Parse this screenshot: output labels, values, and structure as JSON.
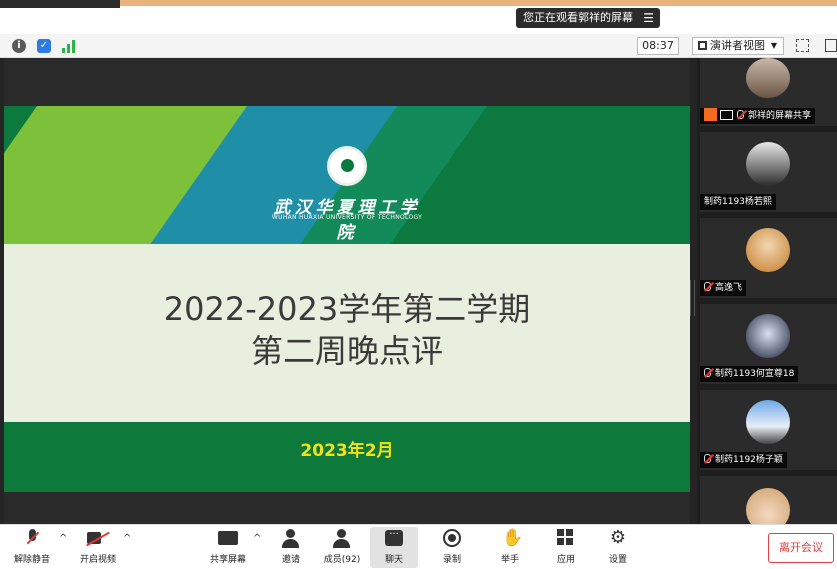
{
  "banner": {
    "viewing_text": "您正在观看郭祥的屏幕",
    "menu_icon": "menu-icon"
  },
  "toolbar": {
    "timer": "08:37",
    "view_label": "演讲者视图",
    "icons": [
      "info-icon",
      "shield-icon",
      "signal-icon",
      "fullscreen-icon",
      "window-icon"
    ]
  },
  "slide": {
    "school_name": "武汉华夏理工学院",
    "school_name_en": "WUHAN HUAXIA UNIVERSITY OF TECHNOLOGY",
    "title_line1": "2022-2023学年第二学期",
    "title_line2": "第二周晚点评",
    "date": "2023年2月",
    "colors": {
      "green": "#0c7a3e",
      "light": "#e9efdf",
      "date_yellow": "#f2e21c"
    }
  },
  "participants": [
    {
      "name": "郭祥的屏幕共享",
      "sharing": true
    },
    {
      "name": "制药1193杨若熙",
      "muted": false
    },
    {
      "name": "高逸飞",
      "muted": true
    },
    {
      "name": "制药1193何宣尊18",
      "muted": true
    },
    {
      "name": "制药1192杨子颖",
      "muted": true
    },
    {
      "name": "",
      "muted": false
    }
  ],
  "controls": {
    "unmute": "解除静音",
    "start_video": "开启视频",
    "share_screen": "共享屏幕",
    "invite": "邀请",
    "members": "成员(92)",
    "chat": "聊天",
    "record": "录制",
    "raise_hand": "举手",
    "apps": "应用",
    "settings": "设置",
    "leave": "离开会议"
  }
}
